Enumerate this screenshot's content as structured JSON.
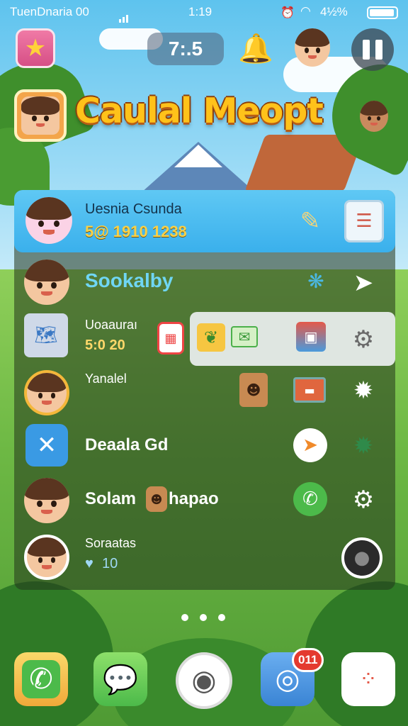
{
  "status_bar": {
    "carrier": "TuenDnaria 00",
    "time": "1:19",
    "battery_percent": "4½%"
  },
  "top_bar": {
    "timer": "7:.5"
  },
  "title": "Caulal Meopt",
  "list": [
    {
      "name": "Uesnia Csunda",
      "detail": "5@ 1910 1238",
      "selected": true
    },
    {
      "name": "Sookalby"
    },
    {
      "name": "Uoaauraı",
      "detail": "5:0 20"
    },
    {
      "name": "Yanalel"
    },
    {
      "name": "Deaala Gd"
    },
    {
      "name": "Solam",
      "name_suffix": "hapao"
    },
    {
      "name": "Soraatas",
      "detail": "10"
    }
  ],
  "dock": {
    "notification_count": "011"
  },
  "colors": {
    "accent_blue": "#3ab0ec",
    "title_gold": "#ffc21a",
    "badge_red": "#e43a2f"
  }
}
